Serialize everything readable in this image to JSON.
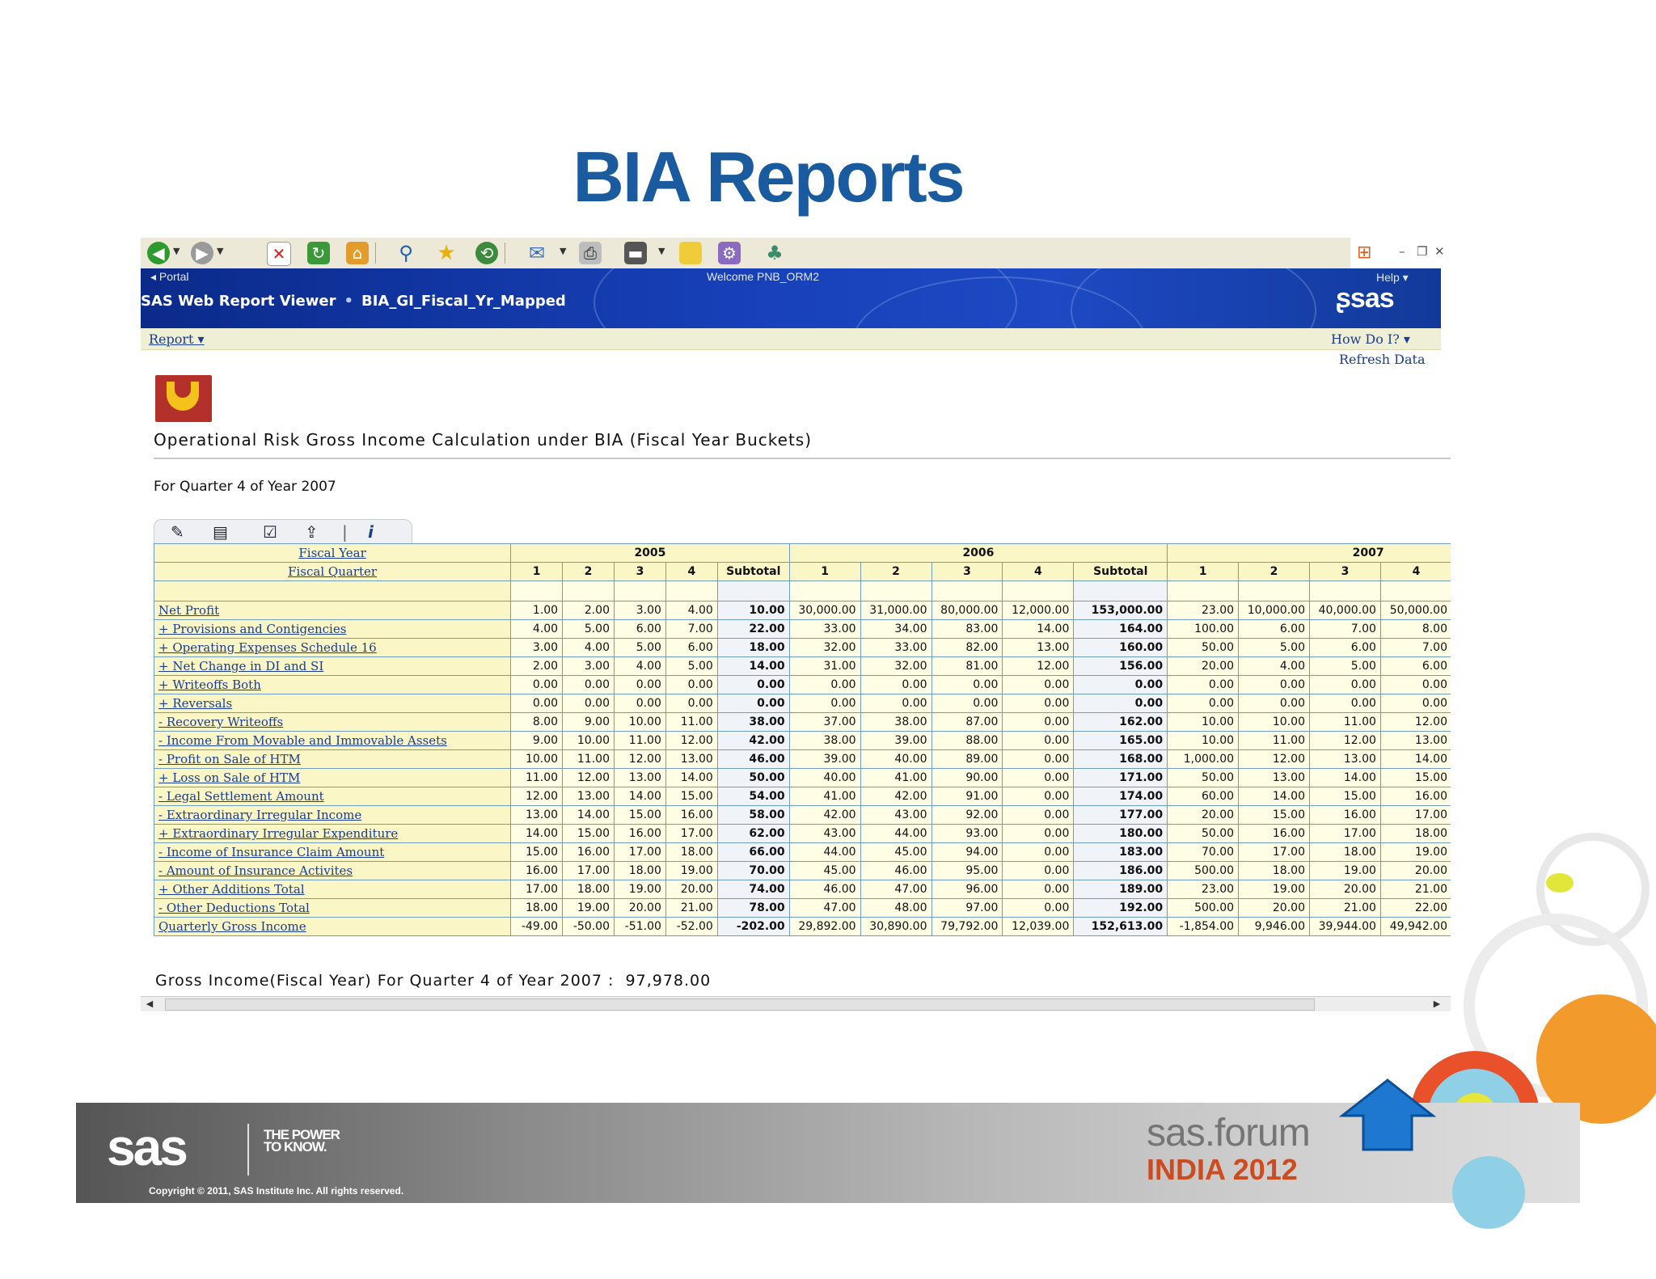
{
  "slide": {
    "title": "BIA Reports",
    "copyright": "Copyright © 2011, SAS Institute Inc. All rights reserved.",
    "sas_logo": "sas",
    "tagline": "THE POWER TO KNOW.",
    "forum_logo": "sas.forum",
    "forum_event": "INDIA",
    "forum_year": "2012"
  },
  "browser": {
    "toolbar_icons": [
      "back-icon",
      "forward-icon",
      "stop-icon",
      "refresh-icon",
      "home-icon",
      "search-icon",
      "favorites-icon",
      "history-icon",
      "mail-icon",
      "print-icon",
      "edit-icon",
      "folder-icon",
      "media-icon",
      "messenger-icon"
    ],
    "window_controls": [
      "minimize",
      "restore",
      "close"
    ]
  },
  "app": {
    "portal_link": "Portal",
    "welcome": "Welcome PNB_ORM2",
    "help": "Help",
    "title": "SAS Web Report Viewer",
    "report_name": "BIA_GI_Fiscal_Yr_Mapped",
    "brand": "sas",
    "menu_report": "Report",
    "menu_how_do_i": "How Do I?",
    "refresh_data": "Refresh Data"
  },
  "report": {
    "title": "Operational Risk Gross Income Calculation under BIA (Fiscal Year Buckets)",
    "subtitle": "For Quarter 4 of Year 2007",
    "fiscal_year_label": "Fiscal Year",
    "fiscal_quarter_label": "Fiscal Quarter",
    "years": [
      "2005",
      "2006",
      "2007"
    ],
    "quarters": [
      "1",
      "2",
      "3",
      "4"
    ],
    "subtotal_label": "Subtotal",
    "rows": [
      {
        "label": "Net Profit",
        "values": [
          "1.00",
          "2.00",
          "3.00",
          "4.00",
          "10.00",
          "30,000.00",
          "31,000.00",
          "80,000.00",
          "12,000.00",
          "153,000.00",
          "23.00",
          "10,000.00",
          "40,000.00",
          "50,000.00"
        ]
      },
      {
        "label": "+ Provisions and Contigencies",
        "values": [
          "4.00",
          "5.00",
          "6.00",
          "7.00",
          "22.00",
          "33.00",
          "34.00",
          "83.00",
          "14.00",
          "164.00",
          "100.00",
          "6.00",
          "7.00",
          "8.00"
        ]
      },
      {
        "label": "+ Operating Expenses Schedule 16",
        "values": [
          "3.00",
          "4.00",
          "5.00",
          "6.00",
          "18.00",
          "32.00",
          "33.00",
          "82.00",
          "13.00",
          "160.00",
          "50.00",
          "5.00",
          "6.00",
          "7.00"
        ]
      },
      {
        "label": "+ Net Change in DI and SI",
        "values": [
          "2.00",
          "3.00",
          "4.00",
          "5.00",
          "14.00",
          "31.00",
          "32.00",
          "81.00",
          "12.00",
          "156.00",
          "20.00",
          "4.00",
          "5.00",
          "6.00"
        ]
      },
      {
        "label": "+ Writeoffs Both",
        "values": [
          "0.00",
          "0.00",
          "0.00",
          "0.00",
          "0.00",
          "0.00",
          "0.00",
          "0.00",
          "0.00",
          "0.00",
          "0.00",
          "0.00",
          "0.00",
          "0.00"
        ]
      },
      {
        "label": "+ Reversals",
        "values": [
          "0.00",
          "0.00",
          "0.00",
          "0.00",
          "0.00",
          "0.00",
          "0.00",
          "0.00",
          "0.00",
          "0.00",
          "0.00",
          "0.00",
          "0.00",
          "0.00"
        ]
      },
      {
        "label": "- Recovery Writeoffs",
        "values": [
          "8.00",
          "9.00",
          "10.00",
          "11.00",
          "38.00",
          "37.00",
          "38.00",
          "87.00",
          "0.00",
          "162.00",
          "10.00",
          "10.00",
          "11.00",
          "12.00"
        ]
      },
      {
        "label": "- Income From Movable and Immovable Assets",
        "values": [
          "9.00",
          "10.00",
          "11.00",
          "12.00",
          "42.00",
          "38.00",
          "39.00",
          "88.00",
          "0.00",
          "165.00",
          "10.00",
          "11.00",
          "12.00",
          "13.00"
        ]
      },
      {
        "label": "- Profit on Sale of HTM",
        "values": [
          "10.00",
          "11.00",
          "12.00",
          "13.00",
          "46.00",
          "39.00",
          "40.00",
          "89.00",
          "0.00",
          "168.00",
          "1,000.00",
          "12.00",
          "13.00",
          "14.00"
        ]
      },
      {
        "label": "+ Loss on Sale of HTM",
        "values": [
          "11.00",
          "12.00",
          "13.00",
          "14.00",
          "50.00",
          "40.00",
          "41.00",
          "90.00",
          "0.00",
          "171.00",
          "50.00",
          "13.00",
          "14.00",
          "15.00"
        ]
      },
      {
        "label": "- Legal Settlement Amount",
        "values": [
          "12.00",
          "13.00",
          "14.00",
          "15.00",
          "54.00",
          "41.00",
          "42.00",
          "91.00",
          "0.00",
          "174.00",
          "60.00",
          "14.00",
          "15.00",
          "16.00"
        ]
      },
      {
        "label": "- Extraordinary Irregular Income",
        "values": [
          "13.00",
          "14.00",
          "15.00",
          "16.00",
          "58.00",
          "42.00",
          "43.00",
          "92.00",
          "0.00",
          "177.00",
          "20.00",
          "15.00",
          "16.00",
          "17.00"
        ]
      },
      {
        "label": "+ Extraordinary Irregular Expenditure",
        "values": [
          "14.00",
          "15.00",
          "16.00",
          "17.00",
          "62.00",
          "43.00",
          "44.00",
          "93.00",
          "0.00",
          "180.00",
          "50.00",
          "16.00",
          "17.00",
          "18.00"
        ]
      },
      {
        "label": "- Income of Insurance Claim Amount",
        "values": [
          "15.00",
          "16.00",
          "17.00",
          "18.00",
          "66.00",
          "44.00",
          "45.00",
          "94.00",
          "0.00",
          "183.00",
          "70.00",
          "17.00",
          "18.00",
          "19.00"
        ]
      },
      {
        "label": "- Amount of Insurance Activites",
        "values": [
          "16.00",
          "17.00",
          "18.00",
          "19.00",
          "70.00",
          "45.00",
          "46.00",
          "95.00",
          "0.00",
          "186.00",
          "500.00",
          "18.00",
          "19.00",
          "20.00"
        ]
      },
      {
        "label": "+ Other Additions Total",
        "values": [
          "17.00",
          "18.00",
          "19.00",
          "20.00",
          "74.00",
          "46.00",
          "47.00",
          "96.00",
          "0.00",
          "189.00",
          "23.00",
          "19.00",
          "20.00",
          "21.00"
        ]
      },
      {
        "label": "- Other Deductions Total",
        "values": [
          "18.00",
          "19.00",
          "20.00",
          "21.00",
          "78.00",
          "47.00",
          "48.00",
          "97.00",
          "0.00",
          "192.00",
          "500.00",
          "20.00",
          "21.00",
          "22.00"
        ]
      },
      {
        "label": "Quarterly Gross Income",
        "values": [
          "-49.00",
          "-50.00",
          "-51.00",
          "-52.00",
          "-202.00",
          "29,892.00",
          "30,890.00",
          "79,792.00",
          "12,039.00",
          "152,613.00",
          "-1,854.00",
          "9,946.00",
          "39,944.00",
          "49,942.00"
        ]
      }
    ],
    "gross_income_label": "Gross Income(Fiscal Year) For Quarter 4 of Year 2007 :",
    "gross_income_value": "97,978.00"
  },
  "colors": {
    "title_blue": "#1a5a9e",
    "banner_blue": "#1740b8",
    "link_blue": "#1a3d8f",
    "cell_yellow": "#fffde4",
    "arrow_blue": "#1e78d0",
    "forum_orange": "#cc4b1f"
  }
}
